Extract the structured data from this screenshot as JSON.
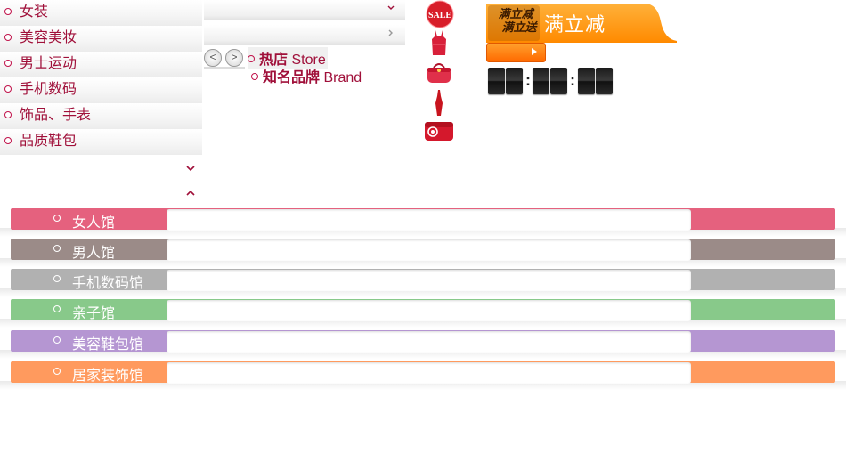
{
  "categories": [
    {
      "label": "女装"
    },
    {
      "label": "美容美妆"
    },
    {
      "label": "男士运动"
    },
    {
      "label": "手机数码"
    },
    {
      "label": "饰品、手表"
    },
    {
      "label": "品质鞋包"
    }
  ],
  "stores": {
    "hot_store_cn": "热店",
    "hot_store_en": "Store",
    "brand_cn": "知名品牌",
    "brand_en": "Brand"
  },
  "nav_buttons": {
    "prev": "<",
    "next": ">"
  },
  "thumbnails": [
    "sale-tag-icon",
    "red-dress-icon",
    "red-handbag-icon",
    "red-gown-icon",
    "red-clutch-icon"
  ],
  "promo": {
    "title": "满立减",
    "badge_line1": "满立减",
    "badge_line2": "满立送"
  },
  "countdown": {
    "digits": [
      "",
      "",
      "",
      "",
      "",
      ""
    ],
    "separator": ":"
  },
  "floors": [
    {
      "label": "女人馆",
      "color": "#e5617e"
    },
    {
      "label": "男人馆",
      "color": "#9b8b88"
    },
    {
      "label": "手机数码馆",
      "color": "#b1b1b1"
    },
    {
      "label": "亲子馆",
      "color": "#88c98a"
    },
    {
      "label": "美容鞋包馆",
      "color": "#b596d2"
    },
    {
      "label": "居家装饰馆",
      "color": "#ff9a5e"
    }
  ],
  "colors": {
    "brand_text": "#a0103a",
    "promo_orange": "#ff8a00"
  }
}
